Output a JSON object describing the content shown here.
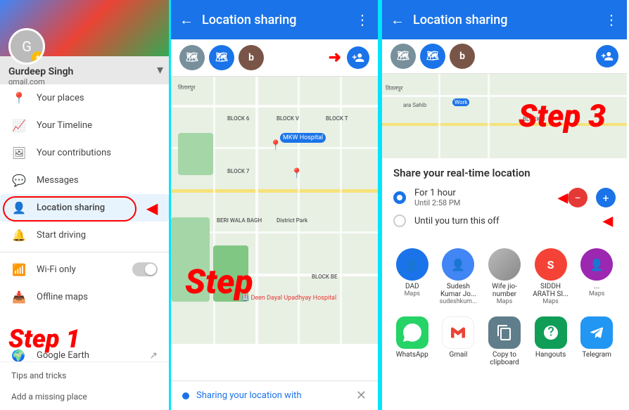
{
  "panel1": {
    "user_name": "Gurdeep Singh",
    "user_email": "gmail.com",
    "menu_items": [
      {
        "id": "your-places",
        "icon": "📍",
        "label": "Your places"
      },
      {
        "id": "your-timeline",
        "icon": "📈",
        "label": "Your Timeline"
      },
      {
        "id": "your-contributions",
        "icon": "🖼",
        "label": "Your contributions"
      },
      {
        "id": "messages",
        "icon": "💬",
        "label": "Messages"
      },
      {
        "id": "location-sharing",
        "icon": "👤",
        "label": "Location sharing",
        "highlighted": true
      },
      {
        "id": "start-driving",
        "icon": "🔔",
        "label": "Start driving"
      },
      {
        "id": "wifi-only",
        "icon": "📶",
        "label": "Wi-Fi only",
        "has_toggle": true
      },
      {
        "id": "offline-maps",
        "icon": "📥",
        "label": "Offline maps"
      },
      {
        "id": "google-earth",
        "icon": "🌍",
        "label": "Google Earth",
        "has_ext": true
      }
    ],
    "bottom_links": [
      "Tips and tricks",
      "Add a missing place"
    ],
    "step_label": "Step 1"
  },
  "panel2": {
    "title": "Location sharing",
    "avatars": [
      {
        "color": "#78909c",
        "text": "👤"
      },
      {
        "color": "#1a73e8",
        "text": "🗺"
      },
      {
        "color": "#795548",
        "text": "b"
      }
    ],
    "add_btn_label": "+",
    "sharing_text": "Sharing your location with",
    "step_label": "Step"
  },
  "panel3": {
    "title": "Location sharing",
    "avatars": [
      {
        "color": "#78909c",
        "text": "👤"
      },
      {
        "color": "#1a73e8",
        "text": "🗺"
      },
      {
        "color": "#795548",
        "text": "b"
      }
    ],
    "share_title": "Share your real-time location",
    "options": [
      {
        "id": "one-hour",
        "selected": true,
        "label": "For 1 hour",
        "sub": "Until 2:58 PM"
      },
      {
        "id": "until-off",
        "selected": false,
        "label": "Until you turn this off",
        "sub": ""
      }
    ],
    "step_label": "Step 3",
    "contacts": [
      {
        "name": "DAD",
        "sub": "Maps",
        "color": "#1a73e8",
        "icon": "👤"
      },
      {
        "name": "Sudesh Kumar Jo...",
        "sub": "sudeshkum...",
        "color": "#4285f4",
        "icon": "👤"
      },
      {
        "name": "Wife jio-number",
        "sub": "Maps",
        "color": "#9e9e9e",
        "icon": "👤"
      },
      {
        "name": "SIDDH ARATH SI...",
        "sub": "Maps",
        "color": "#f44336",
        "icon": "S"
      },
      {
        "name": "...",
        "sub": "Maps",
        "color": "#9c27b0",
        "icon": "👤"
      }
    ],
    "apps": [
      {
        "name": "WhatsApp",
        "icon": "📱",
        "color": "#25d366"
      },
      {
        "name": "Gmail",
        "icon": "✉",
        "color": "#ea4335"
      },
      {
        "name": "Copy to clipboard",
        "icon": "📋",
        "color": "#607d8b"
      },
      {
        "name": "Hangouts",
        "icon": "💬",
        "color": "#0f9d58"
      },
      {
        "name": "Telegram",
        "icon": "✈",
        "color": "#2196f3"
      }
    ]
  }
}
